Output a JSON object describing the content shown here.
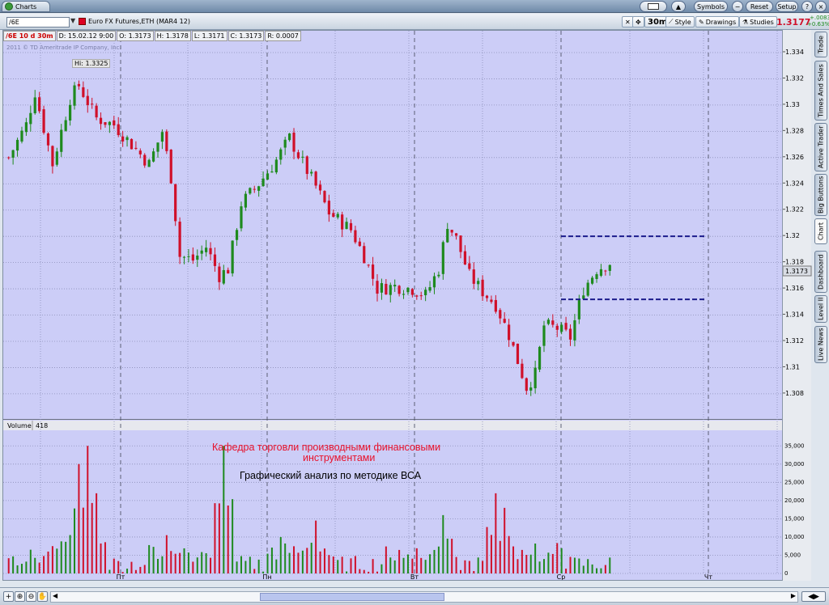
{
  "window": {
    "tab_label": "Charts",
    "symbols": "Symbols",
    "reset": "Reset",
    "setup": "Setup"
  },
  "toolbar": {
    "symbol": "/6E",
    "instrument": "Euro FX Futures,ETH (MAR4 12)",
    "aggregation": "30m",
    "style": "Style",
    "drawings": "Drawings",
    "studies": "Studies",
    "last": "1.3177",
    "change": "+.0083",
    "change_pct": "+0.63%"
  },
  "info": {
    "period": "/6E 10 d 30m",
    "date": "D: 15.02.12 9:00",
    "open": "O: 1.3173",
    "high": "H: 1.3178",
    "low": "L: 1.3171",
    "close": "C: 1.3173",
    "range": "R: 0.0007"
  },
  "copyright": "2011 © TD Ameritrade IP Company, Inc.",
  "hi_label": "Hi: 1.3325",
  "price_marker": "1.3173",
  "volume": {
    "label": "Volume",
    "value": "418"
  },
  "annotation": {
    "line1": "Кафедра торговли производными финансовыми",
    "line2": "инструментами",
    "line3": "Графический анализ по методике ВСА"
  },
  "side_tabs": [
    "Trade",
    "Times And Sales",
    "Active Trader",
    "Big Buttons",
    "Chart",
    "Dashboard",
    "Level II",
    "Live News"
  ],
  "colors": {
    "up": "#1e8a1e",
    "down": "#d0102a",
    "bg": "#cccdf7",
    "level": "#1c1c8c"
  },
  "chart_data": {
    "type": "candlestick",
    "price_ticks": [
      "1.334",
      "1.332",
      "1.33",
      "1.328",
      "1.326",
      "1.324",
      "1.322",
      "1.32",
      "1.318",
      "1.316",
      "1.314",
      "1.312",
      "1.31",
      "1.308"
    ],
    "ylim": [
      1.3067,
      1.3348
    ],
    "volume_ticks": [
      "35,000",
      "30,000",
      "25,000",
      "20,000",
      "15,000",
      "10,000",
      "5,000",
      "0"
    ],
    "vol_max": 37500,
    "days": [
      "Пт",
      "Пн",
      "Вт",
      "Ср",
      "Чт"
    ],
    "levels": [
      1.32,
      1.3152
    ],
    "close_path": [
      [
        0,
        1.326
      ],
      [
        4,
        1.3285
      ],
      [
        6,
        1.331
      ],
      [
        10,
        1.3255
      ],
      [
        14,
        1.3305
      ],
      [
        16,
        1.3315
      ],
      [
        20,
        1.329
      ],
      [
        24,
        1.3285
      ],
      [
        28,
        1.327
      ],
      [
        32,
        1.3255
      ],
      [
        35,
        1.328
      ],
      [
        37,
        1.3245
      ],
      [
        39,
        1.3185
      ],
      [
        42,
        1.3182
      ],
      [
        45,
        1.3192
      ],
      [
        48,
        1.317
      ],
      [
        50,
        1.3175
      ],
      [
        53,
        1.3225
      ],
      [
        57,
        1.324
      ],
      [
        61,
        1.3258
      ],
      [
        64,
        1.3275
      ],
      [
        66,
        1.3262
      ],
      [
        70,
        1.3238
      ],
      [
        73,
        1.3218
      ],
      [
        78,
        1.3205
      ],
      [
        81,
        1.3185
      ],
      [
        84,
        1.316
      ],
      [
        88,
        1.3162
      ],
      [
        92,
        1.316
      ],
      [
        95,
        1.3155
      ],
      [
        98,
        1.3175
      ],
      [
        100,
        1.321
      ],
      [
        102,
        1.3198
      ],
      [
        105,
        1.317
      ],
      [
        108,
        1.3158
      ],
      [
        111,
        1.3148
      ],
      [
        114,
        1.3125
      ],
      [
        116,
        1.3105
      ],
      [
        118,
        1.3085
      ],
      [
        120,
        1.3095
      ],
      [
        122,
        1.3132
      ],
      [
        125,
        1.313
      ],
      [
        128,
        1.3123
      ],
      [
        131,
        1.316
      ],
      [
        134,
        1.3175
      ],
      [
        137,
        1.318
      ]
    ],
    "volume_peaks": [
      [
        18,
        35000
      ],
      [
        49,
        35000
      ],
      [
        99,
        16000
      ],
      [
        111,
        22000
      ],
      [
        113,
        18000
      ],
      [
        70,
        14500
      ],
      [
        62,
        10000
      ],
      [
        36,
        10500
      ],
      [
        10,
        7500
      ],
      [
        16,
        30000
      ],
      [
        20,
        22000
      ]
    ]
  }
}
